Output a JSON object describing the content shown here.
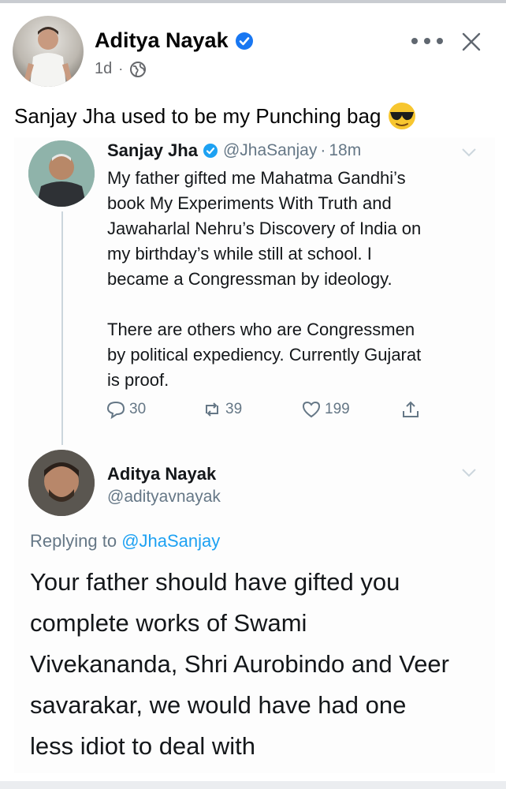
{
  "post": {
    "author": "Aditya Nayak",
    "time": "1d",
    "separator": "·",
    "text": "Sanjay Jha used to be my Punching bag"
  },
  "colors": {
    "facebook_blue": "#1877f2",
    "twitter_blue": "#1da1f2",
    "secondary_text": "#657786"
  },
  "icons": {
    "verified": "verified-badge-icon",
    "privacy": "globe-icon",
    "more": "more-options-icon",
    "close": "close-icon",
    "emoji": "sunglasses-emoji-icon"
  },
  "tweet": {
    "name": "Sanjay Jha",
    "handle": "@JhaSanjay",
    "separator": "·",
    "time": "18m",
    "lines": [
      "My father gifted me  Mahatma Gandhi’s",
      "book My Experiments With Truth and",
      "Jawaharlal Nehru’s Discovery of India on",
      "my birthday’s while still at school. I",
      "became a Congressman by ideology."
    ],
    "lines2": [
      "There are others who are Congressmen",
      "by political expediency. Currently Gujarat",
      "is proof."
    ],
    "replies": "30",
    "retweets": "39",
    "likes": "199"
  },
  "reply": {
    "name": "Aditya Nayak",
    "handle": "@adityavnayak",
    "replying_prefix": "Replying to",
    "replying_to": "@JhaSanjay",
    "lines": [
      "Your father should have gifted you",
      "complete works of Swami",
      "Vivekananda, Shri Aurobindo and Veer",
      "savarakar, we would have had one",
      "less idiot to deal with"
    ]
  }
}
